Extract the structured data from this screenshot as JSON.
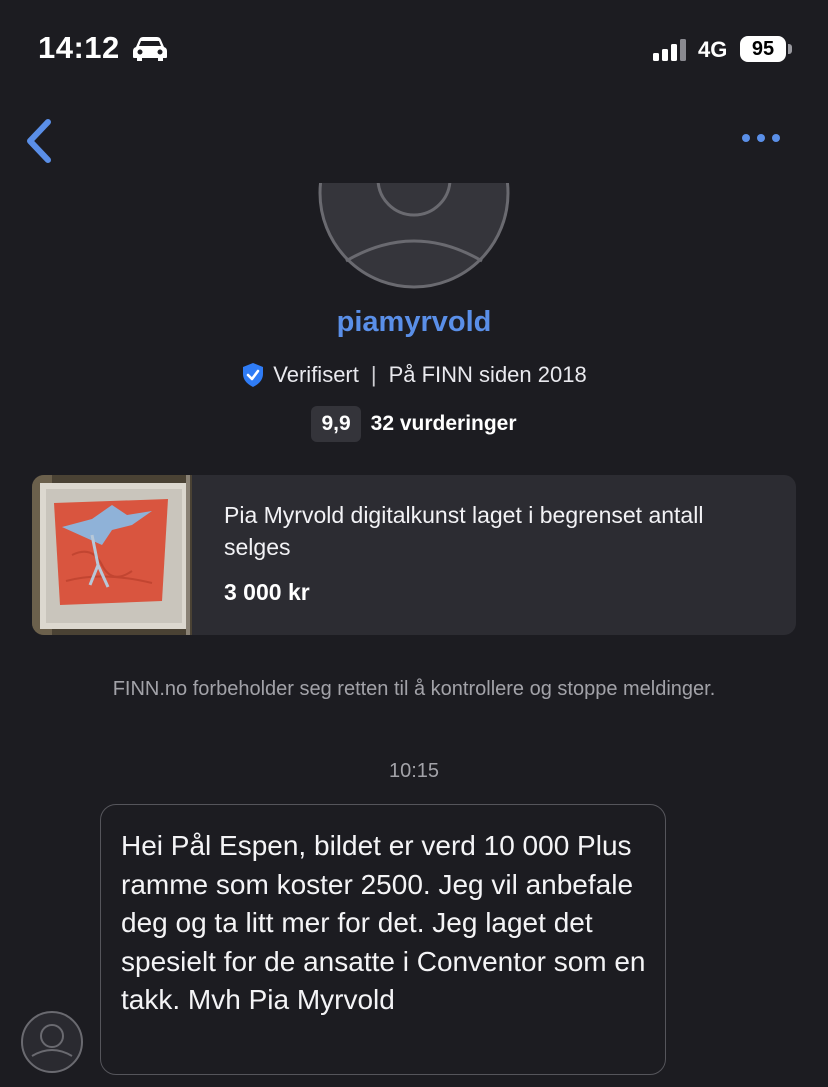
{
  "status_bar": {
    "time": "14:12",
    "network": "4G",
    "battery": "95"
  },
  "nav": {
    "back_icon": "chevron-left-icon",
    "more_icon": "ellipsis-icon",
    "accent_color": "#5a8fe8"
  },
  "profile": {
    "username": "piamyrvold",
    "verified_label": "Verifisert",
    "separator": "|",
    "member_since": "På FINN siden 2018",
    "rating": "9,9",
    "reviews": "32 vurderinger"
  },
  "listing": {
    "title": "Pia Myrvold digitalkunst laget i begrenset antall selges",
    "price": "3 000 kr"
  },
  "disclaimer": "FINN.no forbeholder seg retten til å kontrollere og stoppe meldinger.",
  "conversation": {
    "timestamp": "10:15",
    "messages": [
      {
        "text": "Hei Pål Espen, bildet er verd 10 000 Plus ramme som koster 2500. Jeg vil anbefale deg og ta litt mer for det. Jeg laget det spesielt for de ansatte i Conventor som en takk. Mvh Pia Myrvold"
      }
    ]
  }
}
